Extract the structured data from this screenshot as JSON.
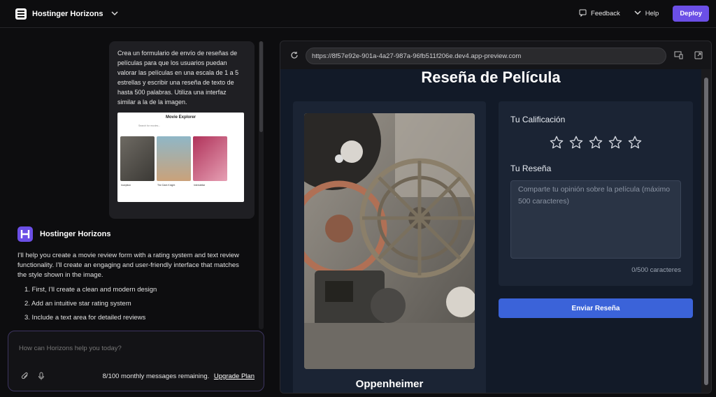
{
  "topbar": {
    "brand": "Hostinger Horizons",
    "feedback": "Feedback",
    "help": "Help",
    "deploy": "Deploy"
  },
  "chat": {
    "user_message": "Crea un formulario de envío de reseñas de películas para que los usuarios puedan valorar las películas en una escala de 1 a 5 estrellas y escribir una reseña de texto de hasta 500 palabras. Utiliza una interfaz similar a la de la imagen.",
    "thumbnail": {
      "title": "Movie Explorer",
      "search": "Search for movies...",
      "cards": [
        "Inception",
        "The Dark Knight",
        "Interstellar"
      ]
    },
    "bot_name": "Hostinger Horizons",
    "bot_intro": "I'll help you create a movie review form with a rating system and text review functionality. I'll create an engaging and user-friendly interface that matches the style shown in the image.",
    "bot_steps": [
      "1. First, I'll create a clean and modern design",
      "2. Add an intuitive star rating system",
      "3. Include a text area for detailed reviews"
    ]
  },
  "composer": {
    "placeholder": "How can Horizons help you today?",
    "remaining": "8/100 monthly messages remaining.",
    "upgrade": "Upgrade Plan"
  },
  "preview": {
    "url": "https://8f57e92e-901a-4a27-987a-96fb511f206e.dev4.app-preview.com",
    "site": {
      "title": "Reseña de Película",
      "movie": "Oppenheimer",
      "rating_label": "Tu Calificación",
      "rating_value": 0,
      "rating_max": 5,
      "review_label": "Tu Reseña",
      "review_placeholder": "Comparte tu opinión sobre la película (máximo 500 caracteres)",
      "counter": "0/500 caracteres",
      "submit": "Enviar Reseña"
    }
  },
  "colors": {
    "accent": "#6b4fe6",
    "submit": "#3b63d9",
    "site_bg": "#121a28",
    "card_bg": "#1b2434"
  }
}
